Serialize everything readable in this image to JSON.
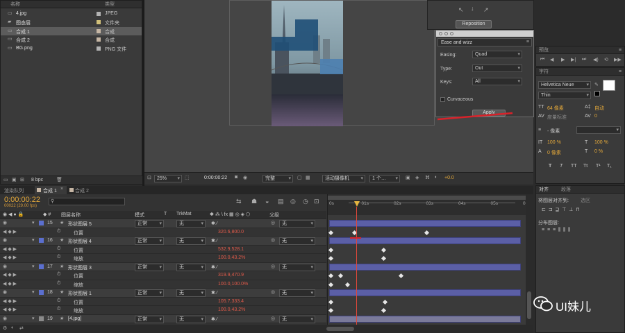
{
  "project": {
    "col_name": "名称",
    "col_type": "类型",
    "items": [
      {
        "name": "4.jpg",
        "type": "JPEG",
        "color": "#b3b3b3"
      },
      {
        "name": "图态层",
        "type": "文件夹",
        "color": "#d1c07a"
      },
      {
        "name": "合成 1",
        "type": "合成",
        "color": "#c6b6a4"
      },
      {
        "name": "合成 2",
        "type": "合成",
        "color": "#c6b6a4"
      },
      {
        "name": "BG.png",
        "type": "PNG 文件",
        "color": "#b3b3b3"
      }
    ],
    "bpc": "8 bpc"
  },
  "viewer": {
    "zoom": "25%",
    "timecode": "0:00:00:22",
    "resolution": "完整",
    "camera": "活动摄像机",
    "views": "1 个…",
    "exposure": "+0.0"
  },
  "reposition": {
    "label": "Reposition"
  },
  "ease": {
    "title": "Ease and wizz",
    "easing_label": "Easing:",
    "easing_value": "Quad",
    "type_label": "Type:",
    "type_value": "Out",
    "keys_label": "Keys:",
    "keys_value": "All",
    "curvaceous_label": "Curvaceous",
    "apply_label": "Apply"
  },
  "preview": {
    "title": "预览"
  },
  "character": {
    "title": "字符",
    "font": "Helvetica Neue",
    "style": "Thin",
    "size": "64 像素",
    "leading": "自动",
    "kerning": "度量标准",
    "tracking": "0",
    "stroke": "- 像素",
    "vscale": "100 %",
    "hscale": "100 %",
    "baseline": "0 像素",
    "tsume": "0 %"
  },
  "align": {
    "tab1": "对齐",
    "tab2": "段落",
    "align_to_label": "将图层对齐到:",
    "align_to_value": "选区",
    "distribute_label": "分布图层:"
  },
  "tabs": {
    "render_queue": "渲染队列",
    "comp1": "合成 1",
    "comp2": "合成 2"
  },
  "timeline": {
    "timecode": "0:00:00:22",
    "frameinfo": "00022 (29.00 fps)",
    "col_layer": "图层名称",
    "col_mode": "模式",
    "col_trkmat": "TrkMat",
    "col_parent": "父级",
    "ruler": [
      "0s",
      "01s",
      "02s",
      "03s",
      "04s",
      "05s",
      "06"
    ],
    "rows": [
      {
        "kind": "layer",
        "num": "15",
        "name": "形状图层 5",
        "mode": "正常",
        "trk": "无",
        "parent": "无",
        "color": "#5b6fcf"
      },
      {
        "kind": "prop",
        "name": "位置",
        "value": "320.6,800.0"
      },
      {
        "kind": "layer",
        "num": "16",
        "name": "形状图层 4",
        "mode": "正常",
        "trk": "无",
        "parent": "无",
        "color": "#5b6fcf"
      },
      {
        "kind": "prop",
        "name": "位置",
        "value": "532.9,528.1"
      },
      {
        "kind": "prop",
        "name": "缩放",
        "value": "100.0,43.2%"
      },
      {
        "kind": "layer",
        "num": "17",
        "name": "形状图层 3",
        "mode": "正常",
        "trk": "无",
        "parent": "无",
        "color": "#5b6fcf"
      },
      {
        "kind": "prop",
        "name": "位置",
        "value": "319.9,470.9"
      },
      {
        "kind": "prop",
        "name": "缩放",
        "value": "100.0,100.0%"
      },
      {
        "kind": "layer",
        "num": "18",
        "name": "形状图层 1",
        "mode": "正常",
        "trk": "无",
        "parent": "无",
        "color": "#5b6fcf"
      },
      {
        "kind": "prop",
        "name": "位置",
        "value": "105.7,333.4"
      },
      {
        "kind": "prop",
        "name": "缩放",
        "value": "100.0,43.2%"
      },
      {
        "kind": "layer",
        "num": "19",
        "name": "[4.jpg]",
        "mode": "正常",
        "trk": "无",
        "parent": "无",
        "color": "#8a8a8a"
      }
    ]
  },
  "watermark": {
    "label": "UI妹儿"
  }
}
